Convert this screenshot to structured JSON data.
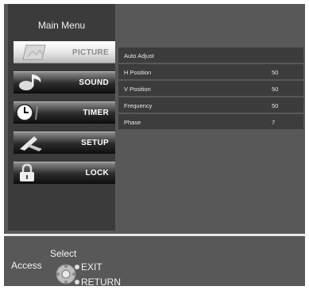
{
  "menu": {
    "title": "Main Menu",
    "items": [
      {
        "label": "PICTURE",
        "icon": "picture-icon",
        "active": true
      },
      {
        "label": "SOUND",
        "icon": "music-note-icon",
        "active": false
      },
      {
        "label": "TIMER",
        "icon": "clock-icon",
        "active": false
      },
      {
        "label": "SETUP",
        "icon": "setup-icon",
        "active": false
      },
      {
        "label": "LOCK",
        "icon": "padlock-icon",
        "active": false
      }
    ]
  },
  "settings": [
    {
      "name": "Auto Adjust",
      "value": ""
    },
    {
      "name": "H Position",
      "value": "50"
    },
    {
      "name": "V Position",
      "value": "50"
    },
    {
      "name": "Frequency",
      "value": "50"
    },
    {
      "name": "Phase",
      "value": "7"
    }
  ],
  "footer": {
    "access": "Access",
    "select": "Select",
    "exit": "EXIT",
    "return": "RETURN"
  }
}
